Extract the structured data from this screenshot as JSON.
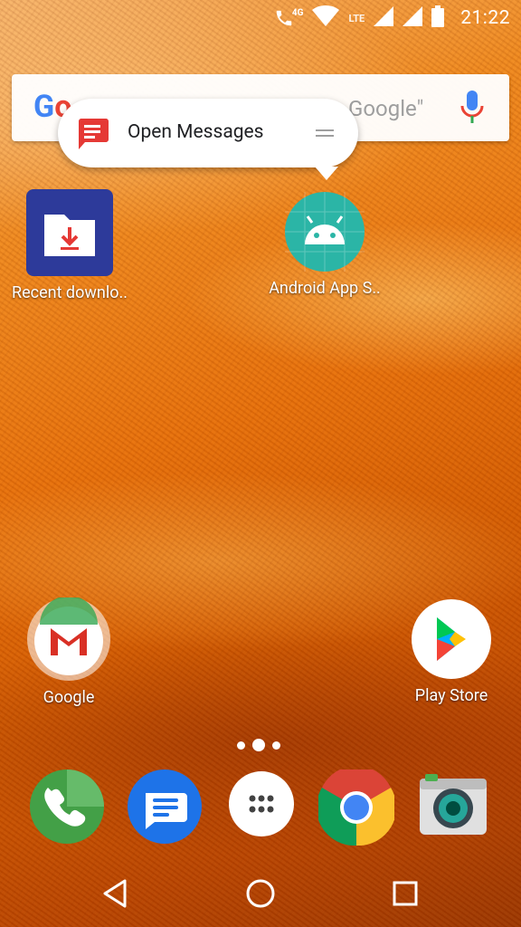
{
  "status_bar": {
    "network_type": "4G",
    "lte_label": "LTE",
    "time": "21:22"
  },
  "search": {
    "logo_text": "Google",
    "hint_fragment": "Google\""
  },
  "shortcut_popup": {
    "label": "Open Messages"
  },
  "home_apps": [
    {
      "label": "Recent downlo..",
      "icon": "download-folder-icon"
    },
    {
      "label": "Android App S..",
      "icon": "android-icon"
    },
    {
      "label": "Google",
      "icon": "gmail-icon"
    },
    {
      "label": "Play Store",
      "icon": "play-store-icon"
    }
  ],
  "dock": [
    {
      "icon": "phone-icon"
    },
    {
      "icon": "messages-icon"
    },
    {
      "icon": "app-drawer-icon"
    },
    {
      "icon": "chrome-icon"
    },
    {
      "icon": "camera-icon"
    }
  ],
  "colors": {
    "accent_blue": "#4285F4",
    "accent_red": "#EA4335",
    "accent_yellow": "#FBBC05",
    "accent_green": "#34A853",
    "android_teal": "#2bb5a6"
  }
}
